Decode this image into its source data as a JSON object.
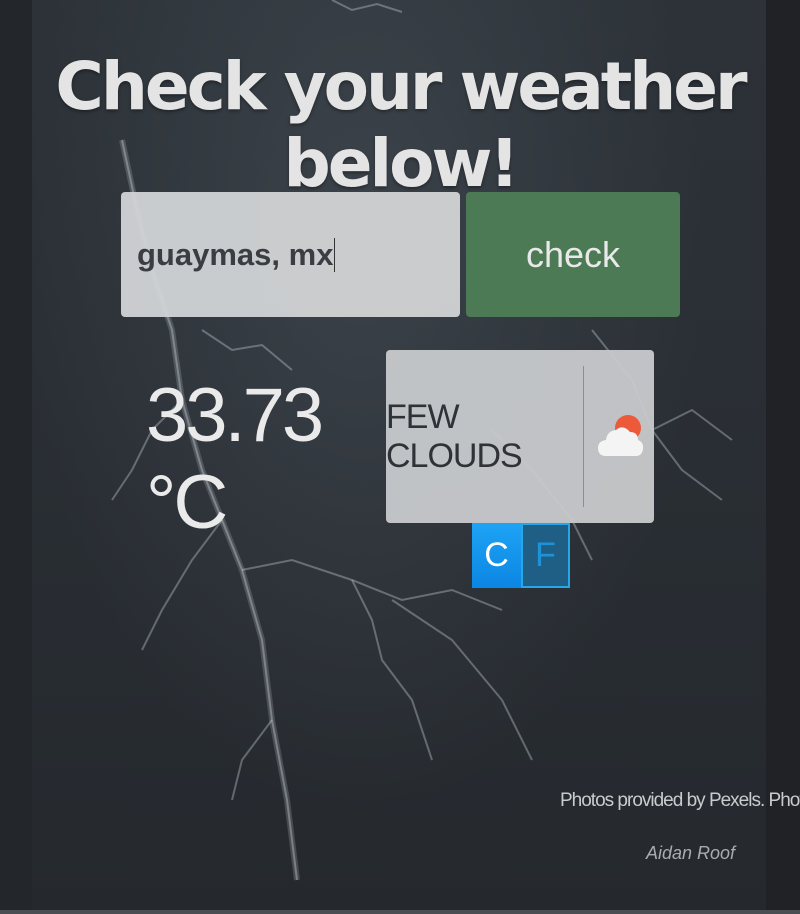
{
  "page": {
    "title": "Check your weather below!"
  },
  "search": {
    "value": "guaymas, mx",
    "button_label": "check"
  },
  "weather": {
    "temperature": "33.73 °C",
    "condition": "FEW CLOUDS",
    "icon": "few-clouds-day-icon"
  },
  "units": {
    "celsius_label": "C",
    "fahrenheit_label": "F",
    "selected": "C"
  },
  "credits": {
    "text": "Photos provided by Pexels. Photo by",
    "author": "Aidan Roof"
  },
  "colors": {
    "check_button": "#4c7a55",
    "unit_celsius_active": "#1a9cf0",
    "unit_fahrenheit": "#1f5f86",
    "cloud": "#f2f2f2",
    "sun": "#ec5a3a"
  }
}
